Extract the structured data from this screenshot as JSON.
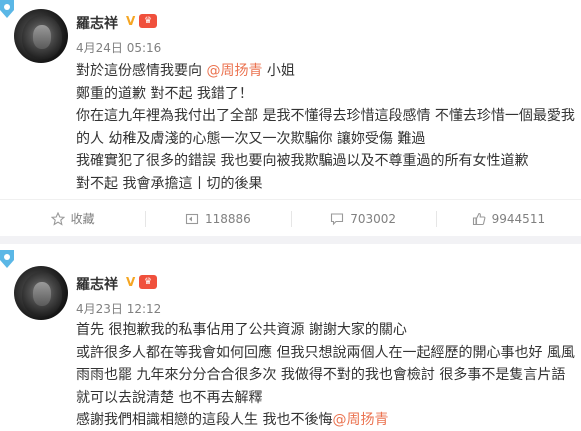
{
  "colors": {
    "mention": "#eb7350",
    "meta": "#808080",
    "verified": "#f5a623",
    "level_badge": "#f0503c"
  },
  "posts": [
    {
      "author": "羅志祥",
      "verified_icon": "v-icon",
      "level_icon": "level-badge-icon",
      "time": "4月24日 05:16",
      "lines": [
        [
          "對於這份感情我要向 ",
          "@周扬青",
          " 小姐"
        ],
        [
          "鄭重的道歉  對不起  我錯了！"
        ],
        [
          "你在這九年裡為我付出了全部  是我不懂得去珍惜這段感情  不懂去珍惜一個最愛我"
        ],
        [
          "的人  幼稚及膚淺的心態一次又一次欺騙你  讓妳受傷  難過"
        ],
        [
          "我確實犯了很多的錯誤  我也要向被我欺騙過以及不尊重過的所有女性道歉"
        ],
        [
          "對不起    我會承擔這丨切的後果"
        ]
      ],
      "actions": {
        "favorite": "收藏",
        "repost": "118886",
        "comment": "703002",
        "like": "9944511"
      }
    },
    {
      "author": "羅志祥",
      "verified_icon": "v-icon",
      "level_icon": "level-badge-icon",
      "time": "4月23日 12:12",
      "lines": [
        [
          "首先  很抱歉我的私事佔用了公共資源  謝謝大家的關心"
        ],
        [
          "或許很多人都在等我會如何回應  但我只想說兩個人在一起經歷的開心事也好  風風"
        ],
        [
          "雨雨也罷  九年來分分合合很多次  我做得不對的我也會檢討  很多事不是隻言片語"
        ],
        [
          "就可以去說清楚  也不再去解釋"
        ],
        [
          "感謝我們相識相戀的這段人生  我也不後悔",
          "@周扬青"
        ]
      ]
    }
  ]
}
